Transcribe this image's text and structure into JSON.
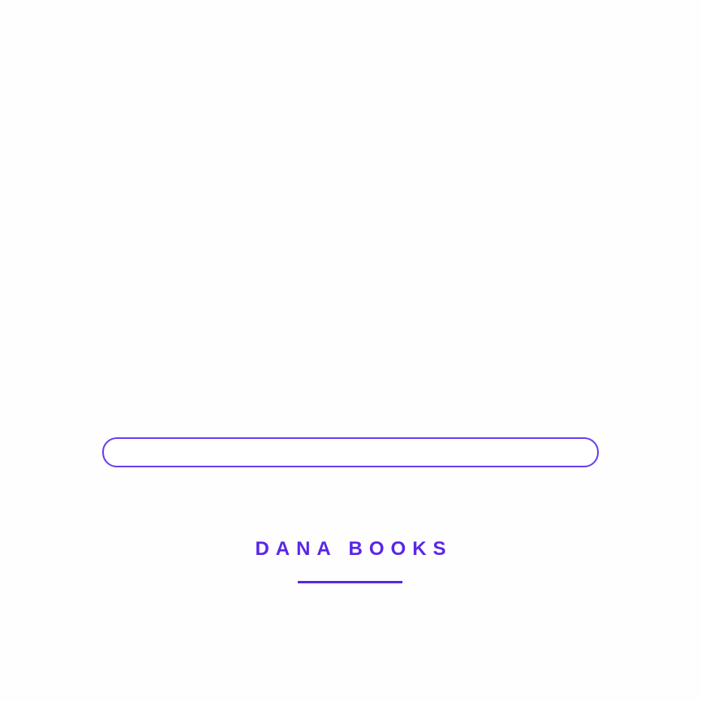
{
  "loader": {
    "progress_fraction": 0
  },
  "brand": {
    "name": "DANA BOOKS"
  },
  "colors": {
    "accent": "#5a26e8",
    "progress_border": "#6a3df0",
    "background": "#fefefe"
  }
}
